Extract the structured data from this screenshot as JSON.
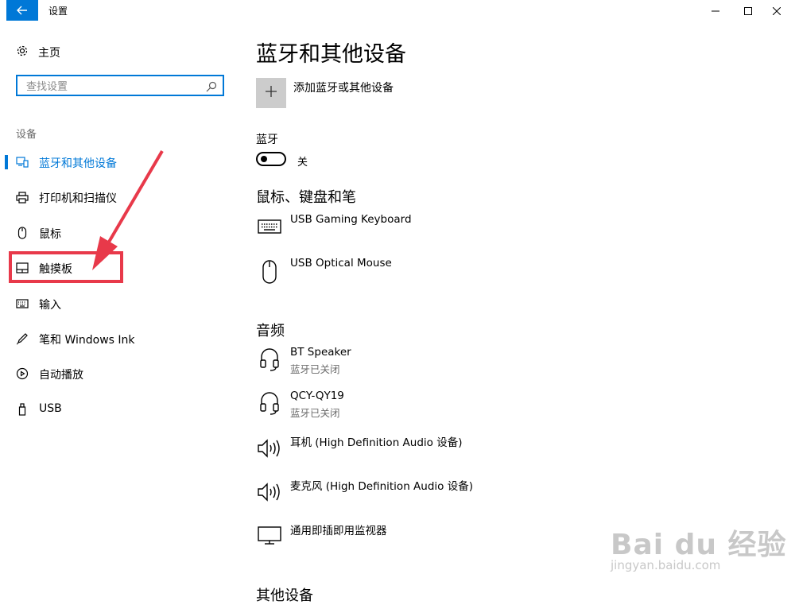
{
  "window": {
    "title": "设置",
    "controls": [
      "minimize-icon",
      "maximize-icon",
      "close-icon"
    ]
  },
  "sidebar": {
    "home_label": "主页",
    "search_placeholder": "查找设置",
    "section_label": "设备",
    "items": [
      {
        "label": "蓝牙和其他设备",
        "icon": "bluetooth-devices-icon",
        "active": true
      },
      {
        "label": "打印机和扫描仪",
        "icon": "printer-icon",
        "active": false
      },
      {
        "label": "鼠标",
        "icon": "mouse-icon",
        "active": false
      },
      {
        "label": "触摸板",
        "icon": "touchpad-icon",
        "active": false
      },
      {
        "label": "输入",
        "icon": "keyboard-icon",
        "active": false
      },
      {
        "label": "笔和 Windows Ink",
        "icon": "pen-icon",
        "active": false
      },
      {
        "label": "自动播放",
        "icon": "autoplay-icon",
        "active": false
      },
      {
        "label": "USB",
        "icon": "usb-icon",
        "active": false
      }
    ]
  },
  "main": {
    "title": "蓝牙和其他设备",
    "add_device_label": "添加蓝牙或其他设备",
    "bluetooth": {
      "heading": "蓝牙",
      "state_label": "关",
      "on": false
    },
    "input_section": {
      "heading": "鼠标、键盘和笔",
      "devices": [
        {
          "name": "USB Gaming Keyboard",
          "status": "",
          "icon": "keyboard-icon"
        },
        {
          "name": "USB Optical Mouse",
          "status": "",
          "icon": "mouse-icon"
        }
      ]
    },
    "audio_section": {
      "heading": "音频",
      "devices": [
        {
          "name": "BT Speaker",
          "status": "蓝牙已关闭",
          "icon": "headset-icon"
        },
        {
          "name": "QCY-QY19",
          "status": "蓝牙已关闭",
          "icon": "headset-icon"
        },
        {
          "name": "耳机 (High Definition Audio 设备)",
          "status": "",
          "icon": "speaker-icon"
        },
        {
          "name": "麦克风 (High Definition Audio 设备)",
          "status": "",
          "icon": "speaker-icon"
        },
        {
          "name": "通用即插即用监视器",
          "status": "",
          "icon": "monitor-icon"
        }
      ]
    },
    "other_heading": "其他设备"
  },
  "watermark": {
    "logo": "Bai du 经验",
    "url": "jingyan.baidu.com"
  },
  "colors": {
    "accent": "#0078d7",
    "annotation": "#e8394a",
    "add_button_bg": "#cccccc"
  }
}
